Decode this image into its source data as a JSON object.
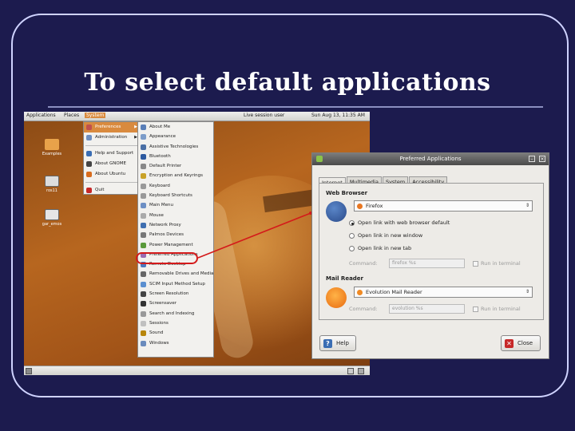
{
  "slide": {
    "title": "To select default applications"
  },
  "desktop": {
    "top_panel": {
      "applications": "Applications",
      "places": "Places",
      "system": "System",
      "user": "Live session user",
      "clock": "Sun Aug 13, 11:35 AM"
    },
    "icons": [
      "Examples",
      "ros11",
      "gar_emos"
    ],
    "system_menu": [
      {
        "label": "Preferences",
        "selected": true,
        "submenu": true
      },
      {
        "label": "Administration",
        "submenu": true
      },
      {
        "label": "Help and Support"
      },
      {
        "label": "About GNOME"
      },
      {
        "label": "About Ubuntu"
      },
      {
        "label": "Quit"
      }
    ],
    "preferences_menu": [
      "About Me",
      "Appearance",
      "Assistive Technologies",
      "Bluetooth",
      "Default Printer",
      "Encryption and Keyrings",
      "Keyboard",
      "Keyboard Shortcuts",
      "Main Menu",
      "Mouse",
      "Network Proxy",
      "Palmos Devices",
      "Power Management",
      "Preferred Applications",
      "Remote Desktop",
      "Removable Drives and Media",
      "SCIM Input Method Setup",
      "Screen Resolution",
      "Screensaver",
      "Search and Indexing",
      "Sessions",
      "Sound",
      "Windows"
    ]
  },
  "dialog": {
    "title": "Preferred Applications",
    "tabs": [
      "Internet",
      "Multimedia",
      "System",
      "Accessibility"
    ],
    "web_browser": {
      "section": "Web Browser",
      "selected": "Firefox",
      "options": [
        "Open link with web browser default",
        "Open link in new window",
        "Open link in new tab"
      ],
      "command_label": "Command:",
      "command_value": "firefox %s",
      "terminal_label": "Run in terminal"
    },
    "mail_reader": {
      "section": "Mail Reader",
      "selected": "Evolution Mail Reader",
      "command_label": "Command:",
      "command_value": "evolution %s",
      "terminal_label": "Run in terminal"
    },
    "help_button": "Help",
    "close_button": "Close"
  },
  "colors": {
    "background": "#1c1b4e",
    "frame": "#cfd3ff",
    "highlight": "#d41a1a",
    "menu_select": "#d98a3e"
  }
}
